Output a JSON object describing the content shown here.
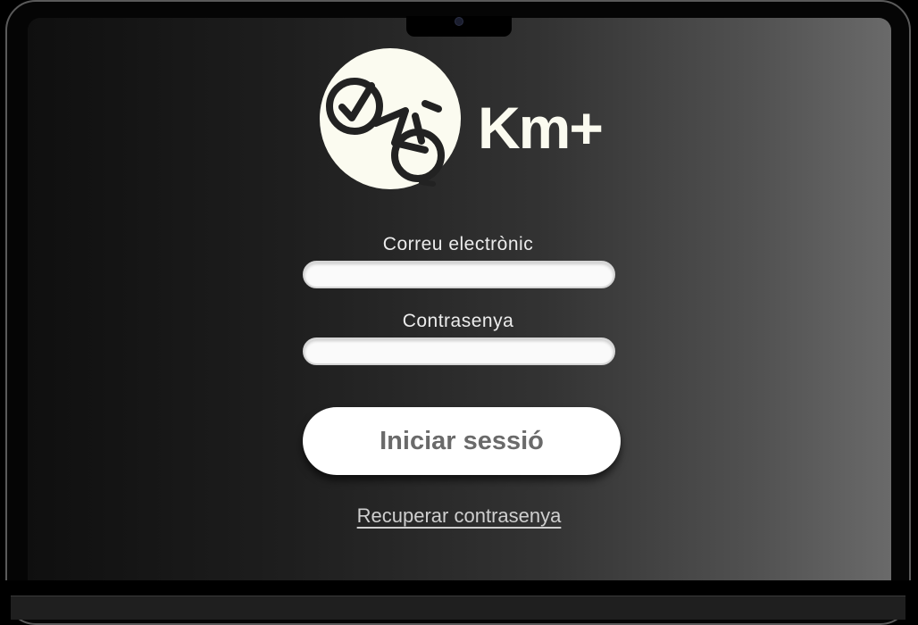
{
  "brand": {
    "name": "Km+",
    "badge_color": "#fbfbf0",
    "logo_icon": "bike-checkmark-icon"
  },
  "form": {
    "email_label": "Correu electrònic",
    "email_value": "",
    "password_label": "Contrasenya",
    "password_value": "",
    "submit_label": "Iniciar sessió",
    "recover_label": "Recuperar contrasenya"
  },
  "colors": {
    "button_bg": "#ffffff",
    "button_text": "#6a6a6a",
    "input_bg": "#fafafa"
  }
}
